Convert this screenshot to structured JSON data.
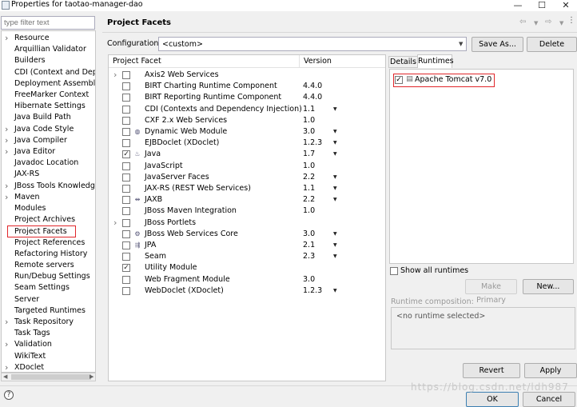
{
  "window": {
    "title": "Properties for taotao-manager-dao",
    "min_glyph": "—",
    "max_glyph": "☐",
    "close_glyph": "✕"
  },
  "nav": {
    "filter_placeholder": "type filter text",
    "items": [
      {
        "label": "Resource",
        "expandable": true
      },
      {
        "label": "Arquillian Validator",
        "expandable": false
      },
      {
        "label": "Builders",
        "expandable": false
      },
      {
        "label": "CDI (Context and Depen",
        "expandable": false
      },
      {
        "label": "Deployment Assembly",
        "expandable": false
      },
      {
        "label": "FreeMarker Context",
        "expandable": false
      },
      {
        "label": "Hibernate Settings",
        "expandable": false
      },
      {
        "label": "Java Build Path",
        "expandable": false
      },
      {
        "label": "Java Code Style",
        "expandable": true
      },
      {
        "label": "Java Compiler",
        "expandable": true
      },
      {
        "label": "Java Editor",
        "expandable": true
      },
      {
        "label": "Javadoc Location",
        "expandable": false
      },
      {
        "label": "JAX-RS",
        "expandable": false
      },
      {
        "label": "JBoss Tools Knowledge",
        "expandable": true
      },
      {
        "label": "Maven",
        "expandable": true
      },
      {
        "label": "Modules",
        "expandable": false
      },
      {
        "label": "Project Archives",
        "expandable": false
      },
      {
        "label": "Project Facets",
        "expandable": false,
        "selected": true
      },
      {
        "label": "Project References",
        "expandable": false
      },
      {
        "label": "Refactoring History",
        "expandable": false
      },
      {
        "label": "Remote servers",
        "expandable": false
      },
      {
        "label": "Run/Debug Settings",
        "expandable": false
      },
      {
        "label": "Seam Settings",
        "expandable": false
      },
      {
        "label": "Server",
        "expandable": false
      },
      {
        "label": "Targeted Runtimes",
        "expandable": false
      },
      {
        "label": "Task Repository",
        "expandable": true
      },
      {
        "label": "Task Tags",
        "expandable": false
      },
      {
        "label": "Validation",
        "expandable": true
      },
      {
        "label": "WikiText",
        "expandable": false
      },
      {
        "label": "XDoclet",
        "expandable": true
      }
    ]
  },
  "page": {
    "title": "Project Facets",
    "config_label": "Configuration:",
    "config_value": "<custom>",
    "save_as_label": "Save As...",
    "delete_label": "Delete"
  },
  "facets": {
    "col_facet": "Project Facet",
    "col_version": "Version",
    "rows": [
      {
        "name": "Axis2 Web Services",
        "version": "",
        "checked": false,
        "expandable": true,
        "dropdown": false,
        "icon": "none"
      },
      {
        "name": "BIRT Charting Runtime Component",
        "version": "4.4.0",
        "checked": false,
        "expandable": false,
        "dropdown": false,
        "icon": "none"
      },
      {
        "name": "BIRT Reporting Runtime Component",
        "version": "4.4.0",
        "checked": false,
        "expandable": false,
        "dropdown": false,
        "icon": "none"
      },
      {
        "name": "CDI (Contexts and Dependency Injection)",
        "version": "1.1",
        "checked": false,
        "expandable": false,
        "dropdown": true,
        "icon": "none"
      },
      {
        "name": "CXF 2.x Web Services",
        "version": "1.0",
        "checked": false,
        "expandable": false,
        "dropdown": false,
        "icon": "none"
      },
      {
        "name": "Dynamic Web Module",
        "version": "3.0",
        "checked": false,
        "expandable": false,
        "dropdown": true,
        "icon": "globe"
      },
      {
        "name": "EJBDoclet (XDoclet)",
        "version": "1.2.3",
        "checked": false,
        "expandable": false,
        "dropdown": true,
        "icon": "none"
      },
      {
        "name": "Java",
        "version": "1.7",
        "checked": true,
        "expandable": false,
        "dropdown": true,
        "icon": "java"
      },
      {
        "name": "JavaScript",
        "version": "1.0",
        "checked": false,
        "expandable": false,
        "dropdown": false,
        "icon": "none"
      },
      {
        "name": "JavaServer Faces",
        "version": "2.2",
        "checked": false,
        "expandable": false,
        "dropdown": true,
        "icon": "none"
      },
      {
        "name": "JAX-RS (REST Web Services)",
        "version": "1.1",
        "checked": false,
        "expandable": false,
        "dropdown": true,
        "icon": "none"
      },
      {
        "name": "JAXB",
        "version": "2.2",
        "checked": false,
        "expandable": false,
        "dropdown": true,
        "icon": "jaxb"
      },
      {
        "name": "JBoss Maven Integration",
        "version": "1.0",
        "checked": false,
        "expandable": false,
        "dropdown": false,
        "icon": "none"
      },
      {
        "name": "JBoss Portlets",
        "version": "",
        "checked": false,
        "expandable": true,
        "dropdown": false,
        "icon": "none"
      },
      {
        "name": "JBoss Web Services Core",
        "version": "3.0",
        "checked": false,
        "expandable": false,
        "dropdown": true,
        "icon": "ws"
      },
      {
        "name": "JPA",
        "version": "2.1",
        "checked": false,
        "expandable": false,
        "dropdown": true,
        "icon": "jpa"
      },
      {
        "name": "Seam",
        "version": "2.3",
        "checked": false,
        "expandable": false,
        "dropdown": true,
        "icon": "none"
      },
      {
        "name": "Utility Module",
        "version": "",
        "checked": true,
        "expandable": false,
        "dropdown": false,
        "icon": "none"
      },
      {
        "name": "Web Fragment Module",
        "version": "3.0",
        "checked": false,
        "expandable": false,
        "dropdown": false,
        "icon": "none"
      },
      {
        "name": "WebDoclet (XDoclet)",
        "version": "1.2.3",
        "checked": false,
        "expandable": false,
        "dropdown": true,
        "icon": "none"
      }
    ]
  },
  "right_tabs": {
    "details": "Details",
    "runtimes": "Runtimes"
  },
  "runtimes": {
    "item_label": "Apache Tomcat v7.0",
    "item_checked": true,
    "show_all_label": "Show all runtimes",
    "make_primary_label": "Make Primary",
    "new_label": "New...",
    "composition_label": "Runtime composition:",
    "composition_value": "<no runtime selected>"
  },
  "footer": {
    "revert_label": "Revert",
    "apply_label": "Apply",
    "ok_label": "OK",
    "cancel_label": "Cancel",
    "watermark": "https://blog.csdn.net/ldh987"
  }
}
